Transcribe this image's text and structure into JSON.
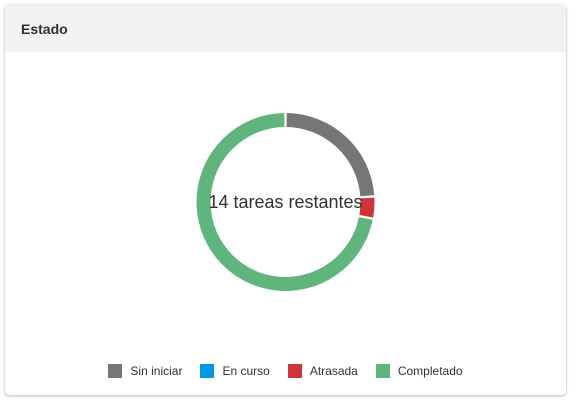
{
  "card": {
    "title": "Estado"
  },
  "chart_data": {
    "type": "pie",
    "variant": "donut",
    "center_label": "14 tareas restantes",
    "legend_position": "bottom",
    "series": [
      {
        "name": "Sin iniciar",
        "value": 12,
        "color": "#767676"
      },
      {
        "name": "En curso",
        "value": 0,
        "color": "#0097e6"
      },
      {
        "name": "Atrasada",
        "value": 2,
        "color": "#d13438"
      },
      {
        "name": "Completado",
        "value": 36,
        "color": "#5fb57d"
      }
    ]
  }
}
